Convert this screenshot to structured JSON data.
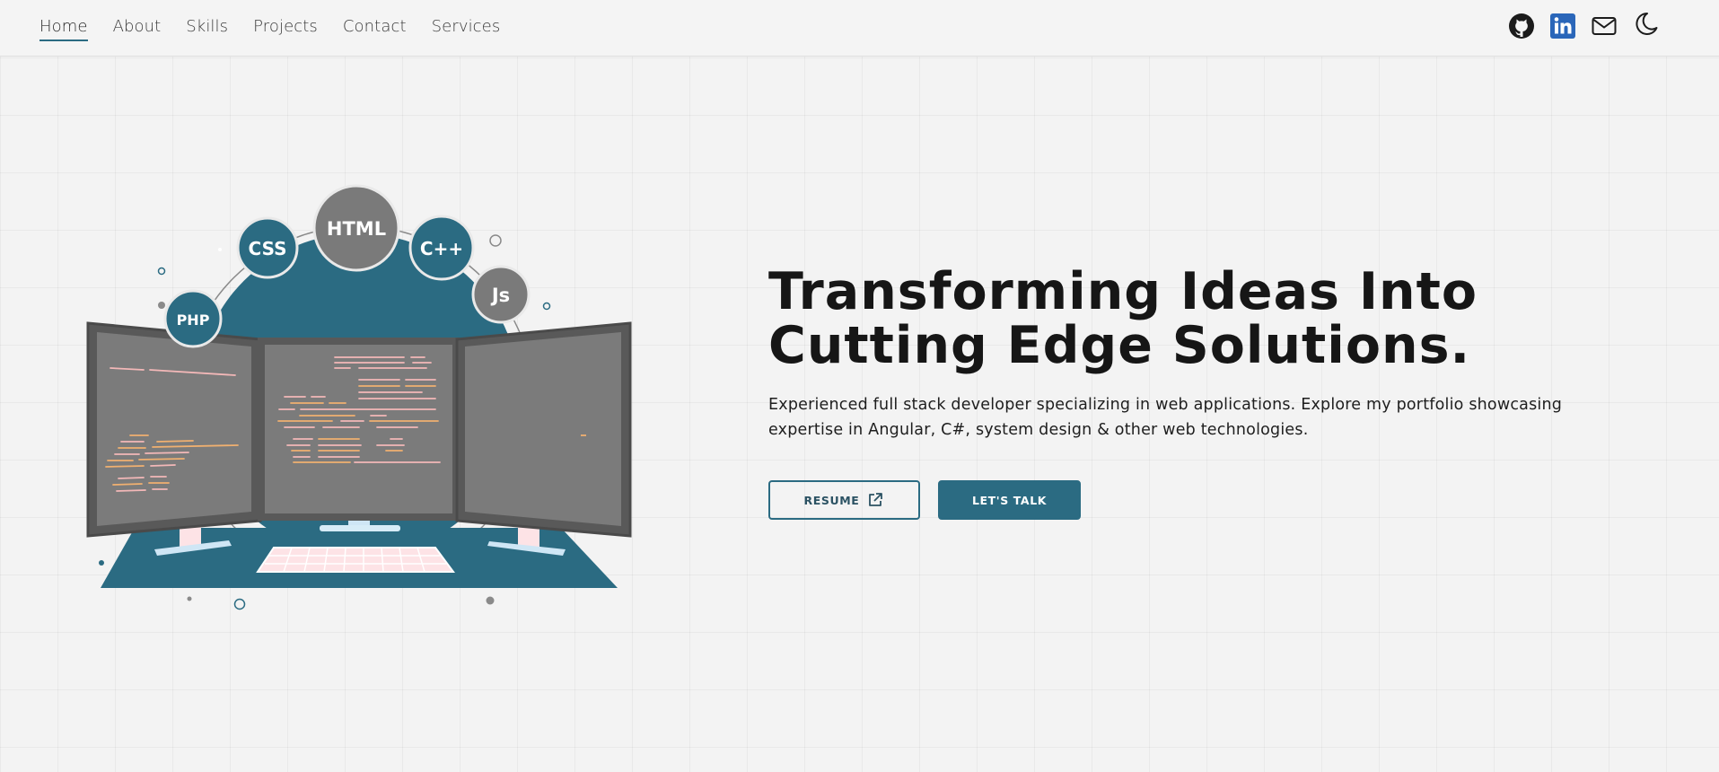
{
  "nav": {
    "links": [
      {
        "label": "Home",
        "active": true
      },
      {
        "label": "About"
      },
      {
        "label": "Skills"
      },
      {
        "label": "Projects"
      },
      {
        "label": "Contact"
      },
      {
        "label": "Services"
      }
    ],
    "icons": [
      "github-icon",
      "linkedin-icon",
      "mail-icon",
      "moon-icon"
    ]
  },
  "illustration": {
    "badges": [
      "PHP",
      "CSS",
      "HTML",
      "C++",
      "Js"
    ]
  },
  "hero": {
    "title_line1": "Transforming Ideas Into",
    "title_line2": "Cutting Edge Solutions.",
    "subtitle": "Experienced full stack developer specializing in web applications. Explore my portfolio showcasing expertise in Angular, C#, system design & other web technologies.",
    "resume_label": "RESUME",
    "talk_label": "LET'S TALK"
  },
  "colors": {
    "accent": "#2b6b82",
    "background": "#f3f3f3",
    "badge_gray": "#7a7a7a",
    "screen_gray": "#7b7b7b",
    "code_pink": "#f3b8b8",
    "code_orange": "#f0b070"
  }
}
